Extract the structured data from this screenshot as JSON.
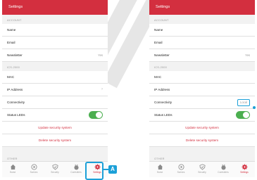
{
  "header": {
    "title": "Settings"
  },
  "sections": {
    "account": "ACCOUNT",
    "device": "ICS-2000",
    "other": "OTHER"
  },
  "rows": {
    "name": "Name",
    "email": "Email",
    "newsletter": {
      "label": "Newsletter",
      "value": "Yes"
    },
    "mac": "MAC",
    "ip": "IP Address",
    "connectivity": {
      "label": "Connectivity",
      "value_right": "Local"
    },
    "status_leds": {
      "label": "Status LEDs",
      "on": true
    }
  },
  "actions": {
    "update": "Update security system",
    "delete": "Delete security system"
  },
  "tabs": [
    "Home",
    "Scenes",
    "Security",
    "Controllers",
    "Settings"
  ],
  "callout": {
    "badge": "A"
  },
  "colors": {
    "brand": "#d32f3f",
    "toggle": "#4caf50",
    "highlight": "#1ca0d8"
  }
}
